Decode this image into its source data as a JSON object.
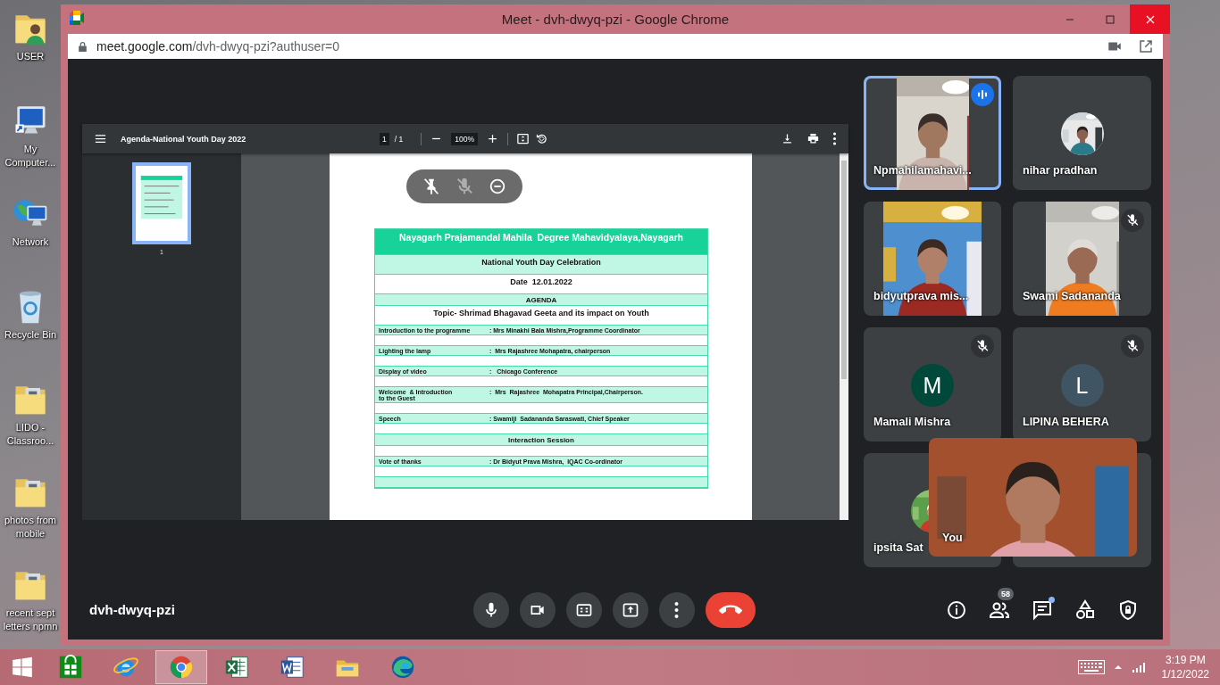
{
  "desktop_icons": [
    {
      "label": "USER",
      "kind": "user-folder"
    },
    {
      "label": "My Computer...",
      "kind": "computer"
    },
    {
      "label": "Network",
      "kind": "network"
    },
    {
      "label": "Recycle Bin",
      "kind": "recycle"
    },
    {
      "label": "LIDO - Classroo...",
      "kind": "folder"
    },
    {
      "label": "photos from mobile",
      "kind": "folder"
    },
    {
      "label": "recent sept letters npmn",
      "kind": "folder"
    }
  ],
  "window": {
    "title": "Meet - dvh-dwyq-pzi - Google Chrome",
    "url_host": "meet.google.com",
    "url_path": "/dvh-dwyq-pzi?authuser=0"
  },
  "presentation": {
    "title": "Agenda-National Youth Day 2022",
    "page": "1",
    "page_of": "/ 1",
    "zoom": "100%",
    "thumbnail_label": "1",
    "thumbnail_selected": true,
    "rows": [
      {
        "kind": "banner",
        "text": "Nayagarh Prajamandal Mahila  Degree Mahavidyalaya,Nayagarh"
      },
      {
        "kind": "title",
        "text": "National Youth Day Celebration",
        "shaded": true
      },
      {
        "kind": "title",
        "text": "Date  12.01.2022",
        "shaded": false
      },
      {
        "kind": "label",
        "text": "AGENDA",
        "shaded": true
      },
      {
        "kind": "title",
        "text": "Topic- Shrimad Bhagavad Geeta and its impact on Youth",
        "shaded": false
      },
      {
        "kind": "item",
        "label": "Introduction to the programme",
        "value": ": Mrs Minakhi Bala Mishra,Programme Coordinator",
        "shaded": true
      },
      {
        "kind": "gap",
        "shaded": false
      },
      {
        "kind": "item",
        "label": "Lighting the lamp",
        "value": ":  Mrs Rajashree Mohapatra, chairperson",
        "shaded": true
      },
      {
        "kind": "gap",
        "shaded": false
      },
      {
        "kind": "item",
        "label": "Display of video",
        "value": ":   Chicago Conference",
        "shaded": true
      },
      {
        "kind": "gap",
        "shaded": false
      },
      {
        "kind": "item",
        "label": "Welcome  & Introduction\nto the Guest",
        "value": ":  Mrs  Rajashree  Mohapatra Principal,Chairperson.",
        "shaded": true
      },
      {
        "kind": "gap",
        "shaded": false
      },
      {
        "kind": "item",
        "label": "Speech",
        "value": ": Swamiji  Sadananda Saraswati, Chief Speaker",
        "shaded": true
      },
      {
        "kind": "gap",
        "shaded": false
      },
      {
        "kind": "label",
        "text": "Interaction Session",
        "shaded": true
      },
      {
        "kind": "gap",
        "shaded": false
      },
      {
        "kind": "item",
        "label": "Vote of thanks",
        "value": ": Dr Bidyut Prava Mishra,  IQAC Co-ordinator",
        "shaded": true
      },
      {
        "kind": "gap",
        "shaded": false
      },
      {
        "kind": "gap",
        "shaded": true
      }
    ]
  },
  "tiles": [
    {
      "name": "Npmahilamahavi...",
      "kind": "video",
      "speaking": true,
      "muted": false
    },
    {
      "name": "nihar pradhan",
      "speaking": false,
      "muted": false
    },
    {
      "name": "bidyutprava mis...",
      "kind": "video",
      "speaking": false,
      "muted": false
    },
    {
      "name": "Swami Sadananda",
      "kind": "video",
      "speaking": false,
      "muted": true
    },
    {
      "name": "Mamali Mishra",
      "kind": "initial",
      "initial": "M",
      "color": "#00483a",
      "speaking": false,
      "muted": true
    },
    {
      "name": "LIPINA BEHERA",
      "kind": "initial",
      "initial": "L",
      "color": "#3f5563",
      "speaking": false,
      "muted": true
    },
    {
      "name": "ipsita Sat",
      "speaking": false,
      "muted": false
    }
  ],
  "self_view": {
    "label": "You"
  },
  "meeting": {
    "code": "dvh-dwyq-pzi",
    "participant_count": "58",
    "chat_unread": true
  },
  "taskbar": {
    "apps": [
      {
        "kind": "store",
        "selected": false
      },
      {
        "kind": "ie",
        "selected": false
      },
      {
        "kind": "chrome",
        "selected": true
      },
      {
        "kind": "excel",
        "selected": false
      },
      {
        "kind": "word",
        "selected": false
      },
      {
        "kind": "explorer",
        "selected": false
      },
      {
        "kind": "edge",
        "selected": false
      }
    ],
    "time": "3:19 PM",
    "date": "1/12/2022"
  }
}
